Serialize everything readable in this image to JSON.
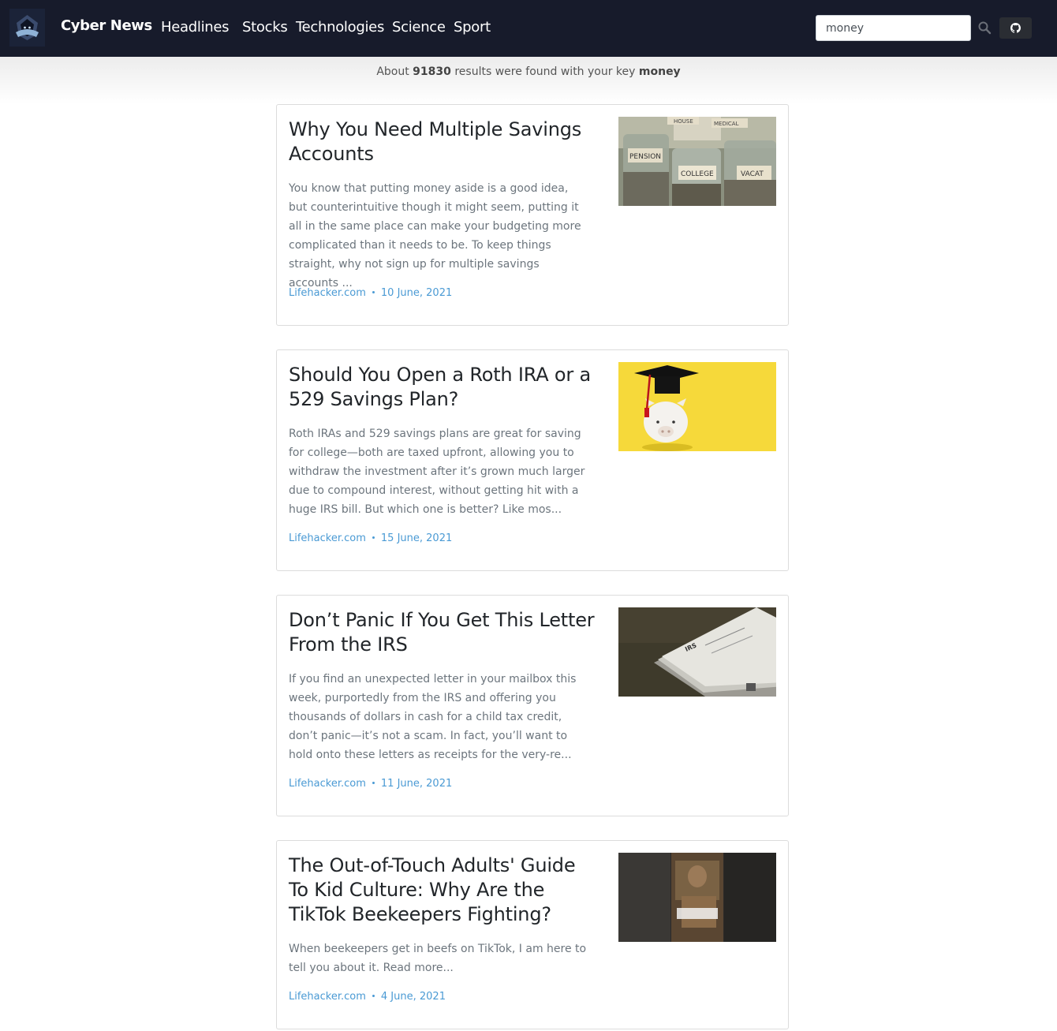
{
  "app": {
    "brand": "Cyber News",
    "nav": [
      {
        "label": "Headlines"
      },
      {
        "label": "Stocks"
      },
      {
        "label": "Technologies"
      },
      {
        "label": "Science"
      },
      {
        "label": "Sport"
      }
    ],
    "search": {
      "value": "money",
      "placeholder": "Search"
    }
  },
  "results": {
    "prefix": "About",
    "count": "91830",
    "middle": "results were found with your key",
    "keyword": "money"
  },
  "articles": [
    {
      "title": "Why You Need Multiple Savings Accounts",
      "description": "You know that putting money aside is a good idea, but counterintuitive though it might seem, putting it all in the same place can make your budgeting more complicated than it needs to be. To keep things straight, why not sign up for multiple savings accounts ...",
      "source": "Lifehacker.com",
      "date": "10 June, 2021",
      "image": "savings-jars-image"
    },
    {
      "title": "Should You Open a Roth IRA or a 529 Savings Plan?",
      "description": "Roth IRAs and 529 savings plans are great for saving for college—both are taxed upfront, allowing you to withdraw the investment after it’s grown much larger due to compound interest, without getting hit with a huge IRS bill. But which one is better? Like mos...",
      "source": "Lifehacker.com",
      "date": "15 June, 2021",
      "image": "piggy-bank-graduation-cap-image"
    },
    {
      "title": "Don’t Panic If You Get This Letter From the IRS",
      "description": "If you find an unexpected letter in your mailbox this week, purportedly from the IRS and offering you thousands of dollars in cash for a child tax credit, don’t panic—it’s not a scam. In fact, you’ll want to hold onto these letters as receipts for the very-re...",
      "source": "Lifehacker.com",
      "date": "11 June, 2021",
      "image": "irs-envelopes-image"
    },
    {
      "title": "The Out-of-Touch Adults' Guide To Kid Culture: Why Are the TikTok Beekeepers Fighting?",
      "description": "When beekeepers get in beefs on TikTok, I am here to tell you about it. Read more...",
      "source": "Lifehacker.com",
      "date": "4 June, 2021",
      "image": "tiktok-beekeeper-image"
    }
  ]
}
